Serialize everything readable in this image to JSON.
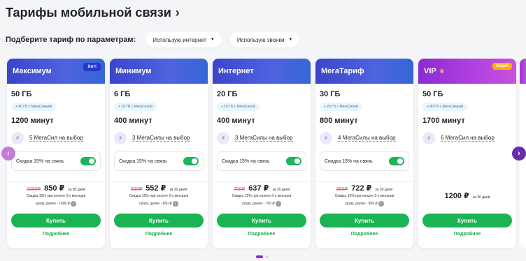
{
  "header": {
    "title": "Тарифы мобильной связи",
    "chevron": "›"
  },
  "filters": {
    "label": "Подберите тариф по параметрам:",
    "options": [
      {
        "label": "Использую интернет",
        "caret": "▼"
      },
      {
        "label": "Использую звонки",
        "caret": "▼"
      }
    ]
  },
  "cards": [
    {
      "name": "Максимум",
      "badge": "Хит!",
      "gb": "50 ГБ",
      "bonus": "+ 40 ГБ с МегаСемьёй",
      "minutes": "1200 минут",
      "mega": "5 МегаСил на выбор",
      "discount": "Скидка 15% на связь",
      "old_price": "1000₽",
      "price": "850 ₽",
      "per": "за 30 дней",
      "promo1": "Скидка 15% при оплате 3-х месяцев",
      "promo2": "сразу, далее - 1000 ₽",
      "buy": "Купить",
      "more": "Подробнее"
    },
    {
      "name": "Минимум",
      "badge": "",
      "gb": "6 ГБ",
      "bonus": "+ 10 ГБ с МегаСилой",
      "minutes": "400 минут",
      "mega": "3 МегаСилы на выбор",
      "discount": "Скидка 15% на связь",
      "old_price": "650₽",
      "price": "552 ₽",
      "per": "за 30 дней",
      "promo1": "Скидка 15% при оплате 3-х месяцев",
      "promo2": "сразу, далее - 650 ₽",
      "buy": "Купить",
      "more": "Подробнее"
    },
    {
      "name": "Интернет",
      "badge": "",
      "gb": "20 ГБ",
      "bonus": "+ 10 ГБ с МегаСилой",
      "minutes": "400 минут",
      "mega": "3 МегаСилы на выбор",
      "discount": "Скидка 15% на связь",
      "old_price": "750₽",
      "price": "637 ₽",
      "per": "за 30 дней",
      "promo1": "Скидка 15% при оплате 3-х месяцев",
      "promo2": "сразу, далее - 750 ₽",
      "buy": "Купить",
      "more": "Подробнее"
    },
    {
      "name": "МегаТариф",
      "badge": "",
      "gb": "30 ГБ",
      "bonus": "+ 20 ГБ с МегаСилой",
      "minutes": "800 минут",
      "mega": "4 МегаСилы на выбор",
      "discount": "Скидка 15% на связь",
      "old_price": "850₽",
      "price": "722 ₽",
      "per": "за 30 дней",
      "promo1": "Скидка 15% при оплате 3-х месяцев",
      "promo2": "сразу, далее - 850 ₽",
      "buy": "Купить",
      "more": "Подробнее"
    },
    {
      "name": "VIP",
      "badge": "Акция",
      "gb": "50 ГБ",
      "bonus": "+ 80 ГБ с МегаСемьёй",
      "minutes": "1700 минут",
      "mega": "6 МегаСил на выбор",
      "price": "1200 ₽",
      "per": "за 30 дней",
      "buy": "Купить",
      "more": "Подробнее"
    }
  ],
  "carousel": {
    "prev": "‹",
    "next": "›",
    "pages": 2,
    "active": 0
  },
  "colors": {
    "accent_green": "#1bb454",
    "header_blue": "#3a45c9",
    "header_purple": "#8b2bd1",
    "badge_orange": "#ffb000"
  }
}
